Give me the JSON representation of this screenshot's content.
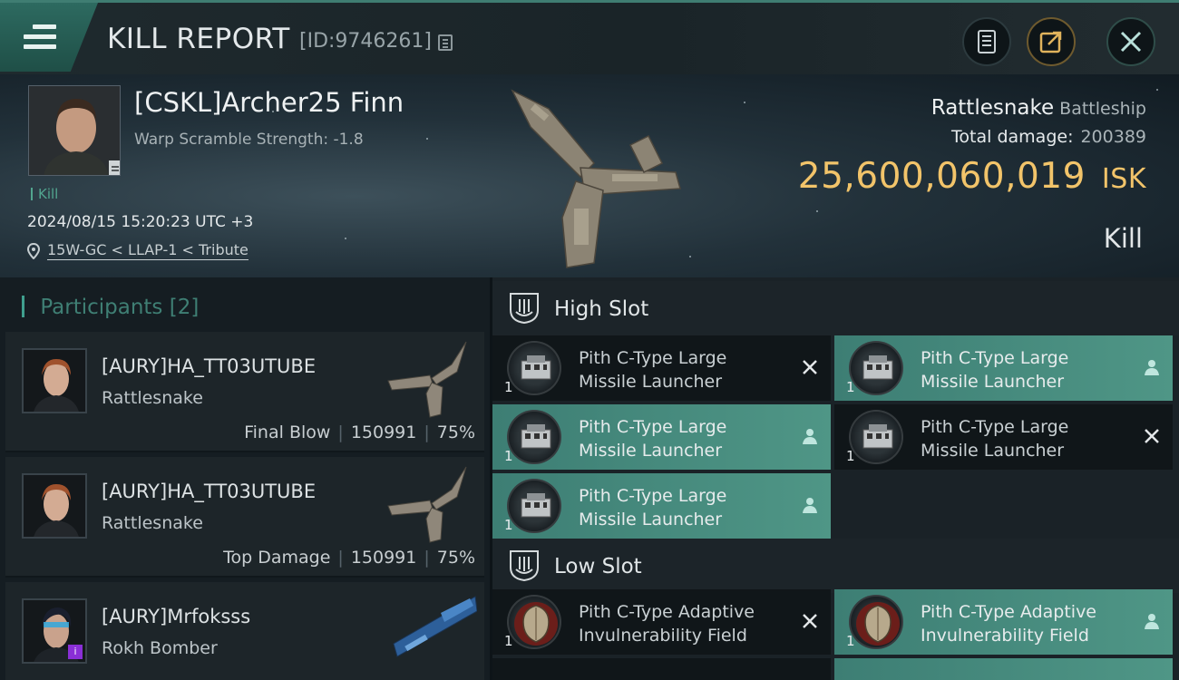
{
  "header": {
    "title": "KILL REPORT",
    "report_id": "[ID:9746261]"
  },
  "hero": {
    "pilot_name": "[CSKL]Archer25 Finn",
    "warp_scramble": "Warp Scramble Strength: -1.8",
    "kill_tag": "Kill",
    "datetime": "2024/08/15 15:20:23 UTC +3",
    "location": "15W-GC < LLAP-1 < Tribute",
    "ship_name": "Rattlesnake",
    "ship_class": "Battleship",
    "total_damage_label": "Total damage:",
    "total_damage": "200389",
    "isk_value": "25,600,060,019",
    "isk_unit": "ISK",
    "result": "Kill"
  },
  "participants": {
    "label": "Participants",
    "count": "[2]",
    "items": [
      {
        "name": "[AURY]HA_TT03UTUBE",
        "ship": "Rattlesnake",
        "role": "Final Blow",
        "damage": "150991",
        "percent": "75%"
      },
      {
        "name": "[AURY]HA_TT03UTUBE",
        "ship": "Rattlesnake",
        "role": "Top Damage",
        "damage": "150991",
        "percent": "75%"
      },
      {
        "name": "[AURY]Mrfoksss",
        "ship": "Rokh Bomber"
      }
    ]
  },
  "fitting": {
    "high_slot": {
      "title": "High Slot",
      "modules": [
        {
          "line1": "Pith C-Type Large",
          "line2": "Missile Launcher",
          "qty": "1",
          "status": "destroyed"
        },
        {
          "line1": "Pith C-Type Large",
          "line2": "Missile Launcher",
          "qty": "1",
          "status": "dropped"
        },
        {
          "line1": "Pith C-Type Large",
          "line2": "Missile Launcher",
          "qty": "1",
          "status": "dropped"
        },
        {
          "line1": "Pith C-Type Large",
          "line2": "Missile Launcher",
          "qty": "1",
          "status": "destroyed"
        },
        {
          "line1": "Pith C-Type Large",
          "line2": "Missile Launcher",
          "qty": "1",
          "status": "dropped"
        }
      ]
    },
    "low_slot": {
      "title": "Low Slot",
      "modules": [
        {
          "line1": "Pith C-Type Adaptive",
          "line2": "Invulnerability Field",
          "qty": "1",
          "status": "destroyed"
        },
        {
          "line1": "Pith C-Type Adaptive",
          "line2": "Invulnerability Field",
          "qty": "1",
          "status": "dropped"
        }
      ]
    }
  },
  "colors": {
    "accent": "#3f7d72",
    "isk": "#f2c46a",
    "highlight": "#4f9686"
  },
  "icons": [
    "menu-icon",
    "copy-icon",
    "report-icon",
    "share-icon",
    "close-icon",
    "location-pin-icon",
    "shield-slot-icon",
    "launcher-icon",
    "invuln-field-icon",
    "dropped-person-icon",
    "destroyed-x-icon"
  ]
}
